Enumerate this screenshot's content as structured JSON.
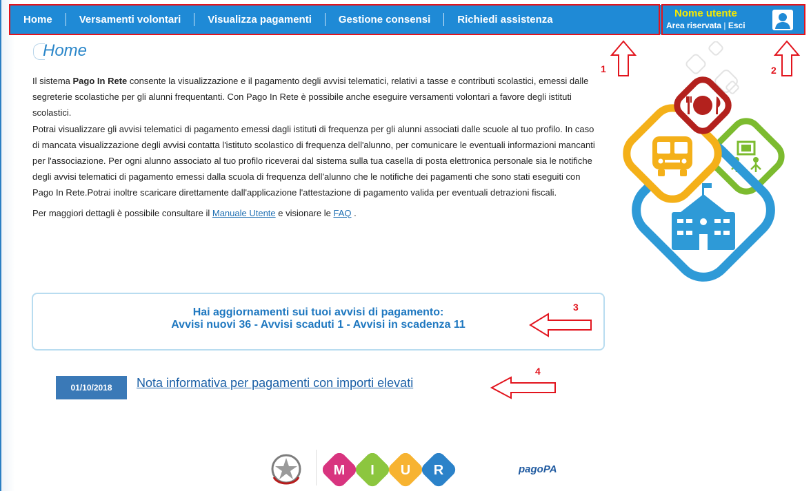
{
  "nav": {
    "items": [
      {
        "label": "Home"
      },
      {
        "label": "Versamenti volontari"
      },
      {
        "label": "Visualizza pagamenti"
      },
      {
        "label": "Gestione consensi"
      },
      {
        "label": "Richiedi assistenza"
      }
    ]
  },
  "user": {
    "name": "Nome utente",
    "area_label": "Area riservata",
    "separator": "|",
    "logout_label": "Esci"
  },
  "page": {
    "title": "Home",
    "intro": {
      "p1_before": "Il sistema ",
      "p1_bold": "Pago In Rete",
      "p1_after": " consente la visualizzazione e il pagamento degli avvisi telematici, relativi a tasse e contributi scolastici, emessi dalle segreterie scolastiche per gli alunni frequentanti. Con Pago In Rete è possibile anche eseguire versamenti volontari a favore degli istituti scolastici.",
      "p2": "Potrai visualizzare gli avvisi telematici di pagamento emessi dagli istituti di frequenza per gli alunni associati dalle scuole al tuo profilo. In caso di mancata visualizzazione degli avvisi contatta l'istituto scolastico di frequenza dell'alunno, per comunicare le eventuali informazioni mancanti per l'associazione. Per ogni alunno associato al tuo profilo riceverai dal sistema sulla tua casella di posta elettronica personale sia le notifiche degli avvisi telematici di pagamento emessi dalla scuola di frequenza dell'alunno che le notifiche dei pagamenti che sono stati eseguiti con Pago In Rete.Potrai inoltre scaricare direttamente dall'applicazione l'attestazione di pagamento valida per eventuali detrazioni fiscali.",
      "p3_before": "Per maggiori dettagli è possibile consultare il ",
      "manual_link": "Manuale Utente",
      "p3_middle": " e visionare le ",
      "faq_link": "FAQ",
      "p3_after": " ."
    },
    "alert": {
      "line1": "Hai aggiornamenti sui tuoi avvisi di pagamento:",
      "line2": "Avvisi nuovi 36 - Avvisi scaduti 1 - Avvisi in scadenza 11"
    },
    "news": {
      "date": "01/10/2018",
      "link": "Nota informativa per pagamenti con importi elevati"
    }
  },
  "annotations": {
    "n1": "1",
    "n2": "2",
    "n3": "3",
    "n4": "4"
  },
  "footer": {
    "miur_letters": [
      "M",
      "I",
      "U",
      "R"
    ],
    "pagopa_label": "pagoPA"
  },
  "colors": {
    "nav_bg": "#1f8ad6",
    "annotation_red": "#e2141d",
    "user_name_yellow": "#f5e900",
    "link_blue": "#1f6fb2",
    "date_badge": "#3a79b7",
    "alert_text": "#1f78c0",
    "illus_red": "#b3211d",
    "illus_yellow": "#f4b019",
    "illus_green": "#7cbb2f",
    "illus_blue": "#2e9ad7",
    "miur_m": "#d8347f",
    "miur_i": "#8cc63f",
    "miur_u": "#f7b331",
    "miur_r": "#2b82c9"
  },
  "icons": {
    "user_avatar": "user-avatar-icon",
    "arrow_up": "arrow-up-icon",
    "arrow_left": "arrow-left-icon",
    "illustration": "school-illustration",
    "emblem": "italian-republic-emblem",
    "miur_logo": "miur-logo",
    "pagopa_logo": "pagopa-logo"
  }
}
